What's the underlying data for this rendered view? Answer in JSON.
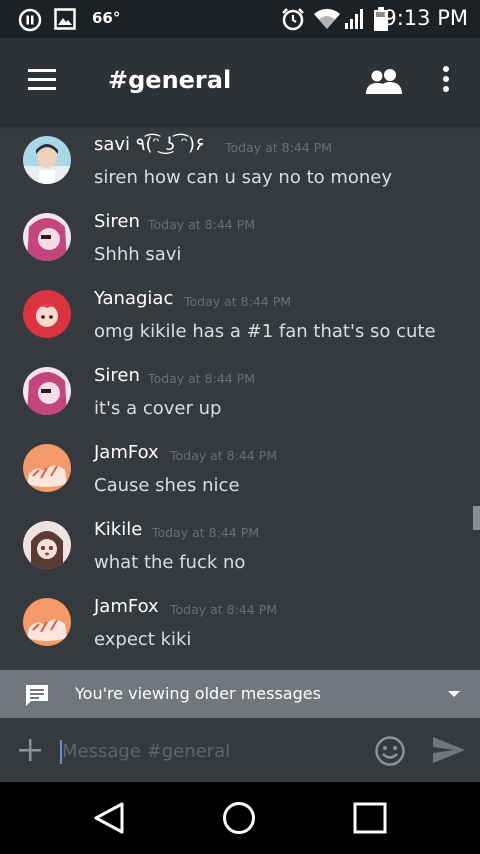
{
  "status_bar": {
    "temperature": "66°",
    "time": "9:13 PM",
    "icons": [
      "pause-icon",
      "image-icon",
      "alarm-icon",
      "wifi-icon",
      "signal-icon",
      "battery-icon"
    ]
  },
  "header": {
    "channel_title": "#general",
    "icons": [
      "hamburger-menu-icon",
      "members-icon",
      "overflow-menu-icon"
    ]
  },
  "messages": [
    {
      "author": "savi ٩(͡ᵔ ͜ʖ ͡ᵔ)۶",
      "timestamp": "Today at 8:44 PM",
      "content": "siren how can u say no to money"
    },
    {
      "author": "Siren",
      "timestamp": "Today at 8:44 PM",
      "content": "Shhh savi"
    },
    {
      "author": "Yanagiac",
      "timestamp": "Today at 8:44 PM",
      "content": "omg kikile has a #1 fan that's so cute"
    },
    {
      "author": "Siren",
      "timestamp": "Today at 8:44 PM",
      "content": "it's a cover up"
    },
    {
      "author": "JamFox",
      "timestamp": "Today at 8:44 PM",
      "content": "Cause shes nice"
    },
    {
      "author": "Kikile",
      "timestamp": "Today at 8:44 PM",
      "content": "what the fuck no"
    },
    {
      "author": "JamFox",
      "timestamp": "Today at 8:44 PM",
      "content": "expect kiki"
    }
  ],
  "older_messages_bar": {
    "label": "You're viewing older messages"
  },
  "composer": {
    "placeholder": "Message #general"
  },
  "colors": {
    "background": "#36393e",
    "header": "#2e3136",
    "older_bar": "#72767d",
    "accent": "#7289da"
  }
}
